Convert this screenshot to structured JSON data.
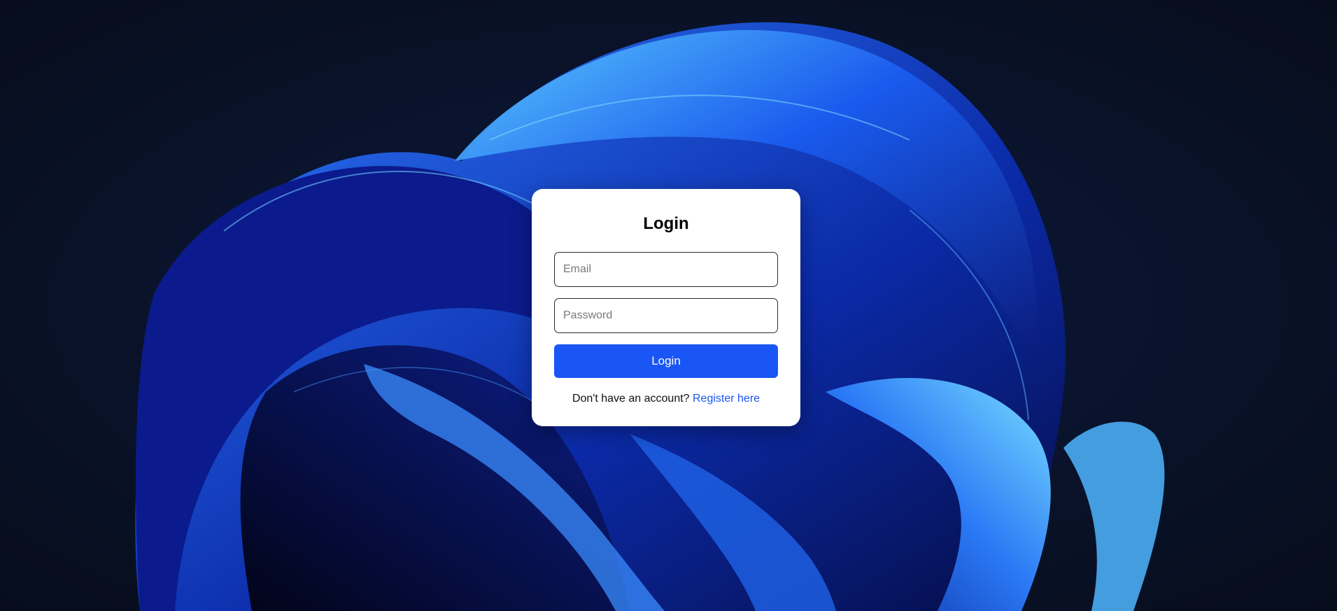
{
  "login": {
    "title": "Login",
    "email_placeholder": "Email",
    "password_placeholder": "Password",
    "button_label": "Login",
    "register_prompt": "Don't have an account?",
    "register_link": "Register here"
  },
  "colors": {
    "background": "#0a1226",
    "accent": "#1a56f5",
    "card": "#ffffff"
  }
}
